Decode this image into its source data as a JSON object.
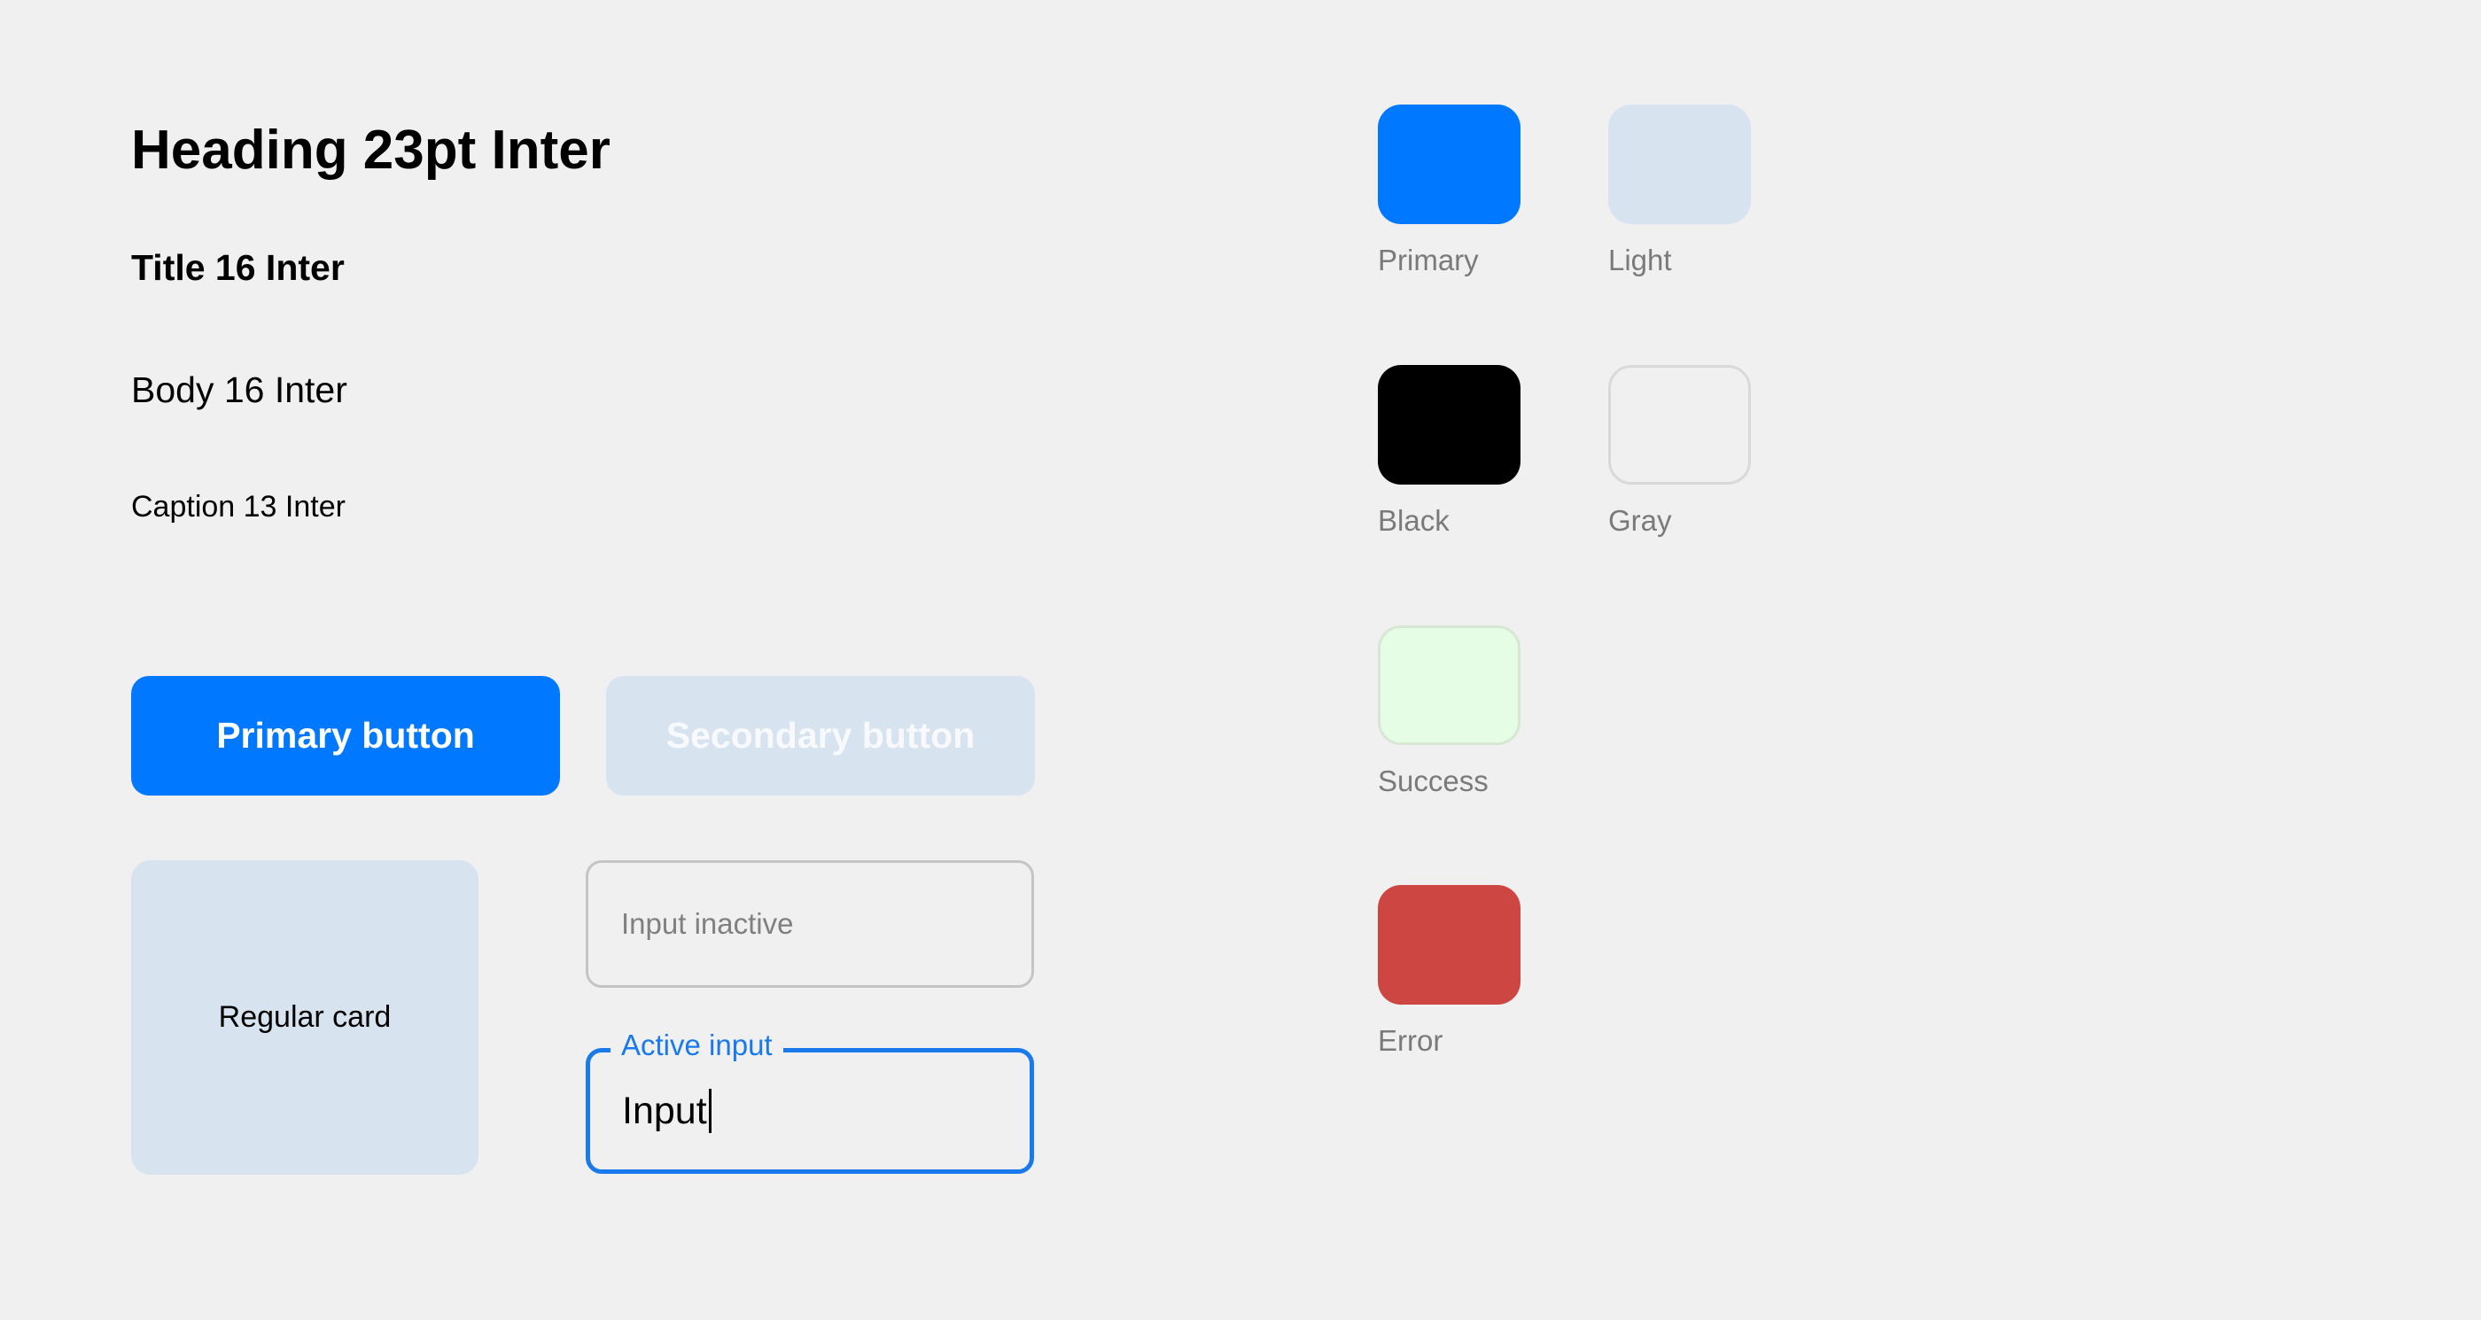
{
  "typography": {
    "heading": "Heading 23pt Inter",
    "title": "Title 16 Inter",
    "body": "Body 16 Inter",
    "caption": "Caption 13 Inter"
  },
  "buttons": {
    "primary_label": "Primary button",
    "secondary_label": "Secondary button"
  },
  "card": {
    "label": "Regular card"
  },
  "inputs": {
    "inactive": {
      "placeholder": "Input inactive",
      "value": ""
    },
    "active": {
      "label": "Active input",
      "value": "Input"
    }
  },
  "colors": [
    {
      "name": "Primary",
      "hex": "#0078ff"
    },
    {
      "name": "Light",
      "hex": "#d8e3f0"
    },
    {
      "name": "Black",
      "hex": "#000000"
    },
    {
      "name": "Gray",
      "hex": "#f0f0f0"
    },
    {
      "name": "Success",
      "hex": "#e6fde5"
    },
    {
      "name": "Error",
      "hex": "#cd4642"
    }
  ]
}
